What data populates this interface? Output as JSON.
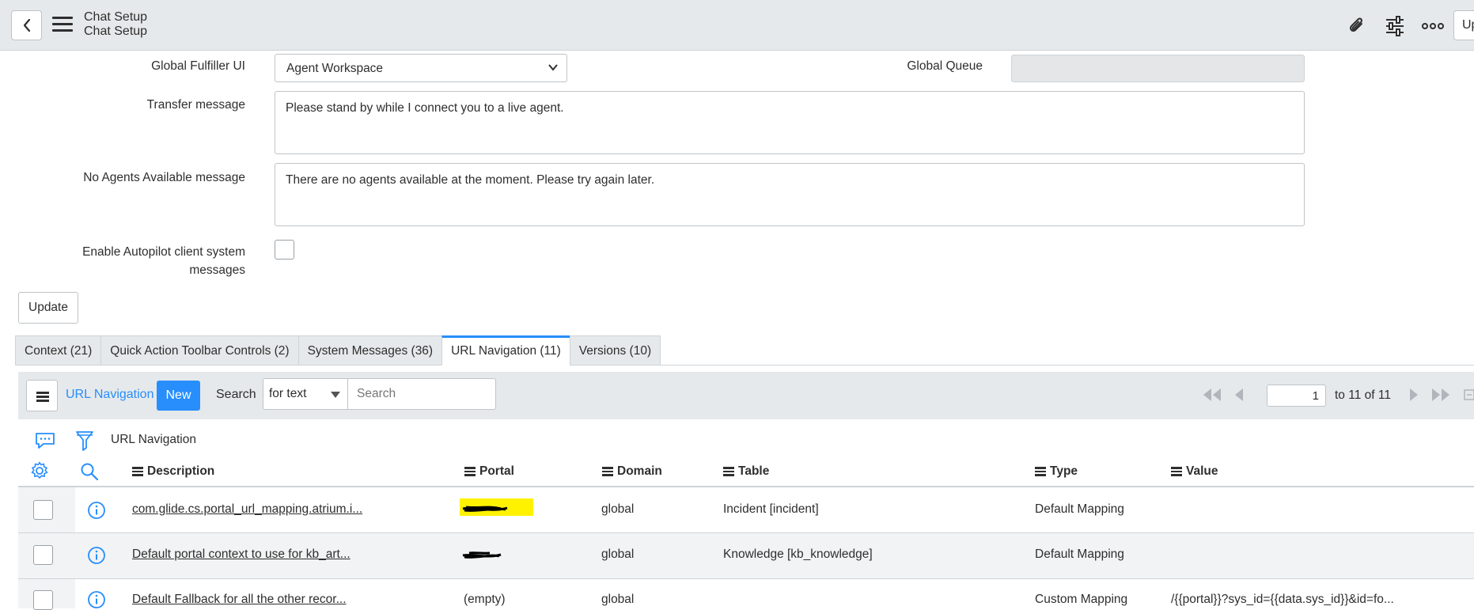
{
  "header": {
    "title": "Chat Setup",
    "subtitle": "Chat Setup",
    "update_label": "Up"
  },
  "form": {
    "global_fulfiller_ui": {
      "label": "Global Fulfiller UI",
      "value": "Agent Workspace"
    },
    "global_queue": {
      "label": "Global Queue",
      "value": ""
    },
    "transfer_message": {
      "label": "Transfer message",
      "value": "Please stand by while I connect you to a live agent."
    },
    "no_agents_message": {
      "label": "No Agents Available message",
      "value": "There are no agents available at the moment.  Please try again later."
    },
    "autopilot": {
      "label_line1": "Enable Autopilot client system",
      "label_line2": "messages",
      "checked": false
    },
    "update_button": "Update"
  },
  "tabs": [
    {
      "label": "Context (21)",
      "active": false
    },
    {
      "label": "Quick Action Toolbar Controls (2)",
      "active": false
    },
    {
      "label": "System Messages (36)",
      "active": false
    },
    {
      "label": "URL Navigation (11)",
      "active": true
    },
    {
      "label": "Versions (10)",
      "active": false
    }
  ],
  "list": {
    "title": "URL Navigation",
    "new_label": "New",
    "search_label": "Search",
    "search_field": "for text",
    "search_placeholder": "Search",
    "page_value": "1",
    "page_range": "to 11 of 11",
    "breadcrumb": "URL Navigation",
    "accent_color": "#278efc",
    "columns": [
      "Description",
      "Portal",
      "Domain",
      "Table",
      "Type",
      "Value"
    ],
    "rows": [
      {
        "description": "com.glide.cs.portal_url_mapping.atrium.i...",
        "portal": "",
        "domain": "global",
        "table": "Incident [incident]",
        "type": "Default Mapping",
        "value": ""
      },
      {
        "description": "Default portal context to use for kb_art...",
        "portal": "",
        "domain": "global",
        "table": "Knowledge [kb_knowledge]",
        "type": "Default Mapping",
        "value": ""
      },
      {
        "description": "Default Fallback for all the other recor...",
        "portal": "(empty)",
        "domain": "global",
        "table": "",
        "type": "Custom Mapping",
        "value": "/{{portal}}?sys_id={{data.sys_id}}&id=fo..."
      }
    ]
  }
}
